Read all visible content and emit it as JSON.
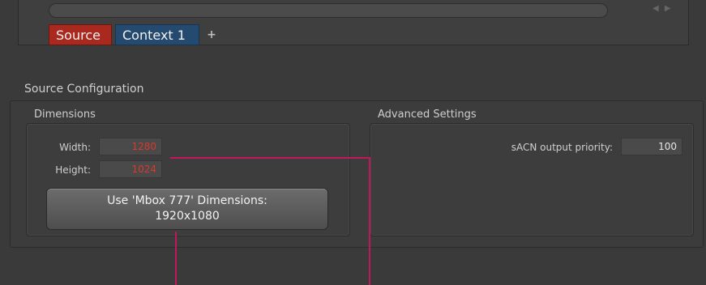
{
  "tabs": {
    "items": [
      {
        "label": "Source"
      },
      {
        "label": "Context 1"
      }
    ],
    "add_icon": "plus-icon"
  },
  "source_config": {
    "title": "Source Configuration",
    "dimensions": {
      "title": "Dimensions",
      "width_label": "Width:",
      "width_value": "1280",
      "height_label": "Height:",
      "height_value": "1024",
      "button_line1": "Use 'Mbox 777' Dimensions:",
      "button_line2": "1920x1080"
    },
    "advanced": {
      "title": "Advanced Settings",
      "priority_label": "sACN output priority:",
      "priority_value": "100"
    }
  },
  "colors": {
    "tab_source": "#a9291f",
    "tab_context": "#254a70",
    "value_red": "#d8392a",
    "callout_line": "#c2185b"
  }
}
